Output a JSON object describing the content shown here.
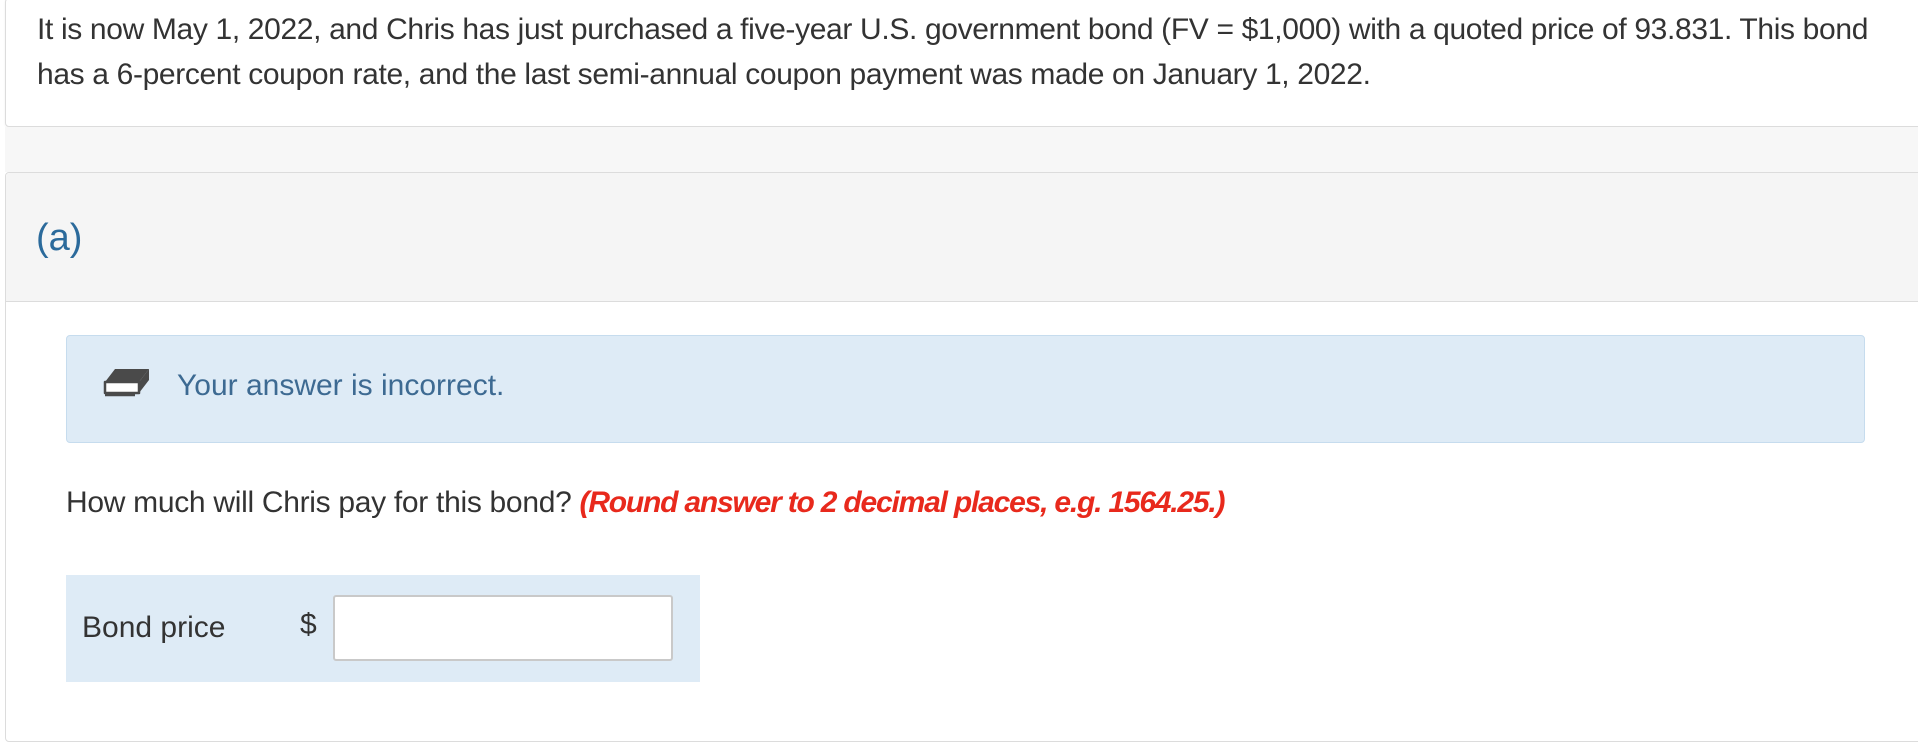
{
  "question": {
    "text": "It is now May 1, 2022, and Chris has just purchased a five-year U.S. government bond (FV = $1,000) with a quoted price of 93.831. This bond has a 6-percent coupon rate, and the last semi-annual coupon payment was made on January 1, 2022."
  },
  "part": {
    "label": "(a)"
  },
  "feedback": {
    "icon": "eraser-icon",
    "message": "Your answer is incorrect.",
    "colors": {
      "background": "#deebf6",
      "text": "#3d6a92"
    }
  },
  "prompt": {
    "question": "How much will Chris pay for this bond?",
    "hint": "(Round answer to 2 decimal places, e.g. 1564.25.)",
    "hint_color": "#e8291c"
  },
  "answer": {
    "label": "Bond price",
    "currency_symbol": "$",
    "value": "",
    "placeholder": ""
  },
  "colors": {
    "part_label": "#2b6a9b"
  }
}
